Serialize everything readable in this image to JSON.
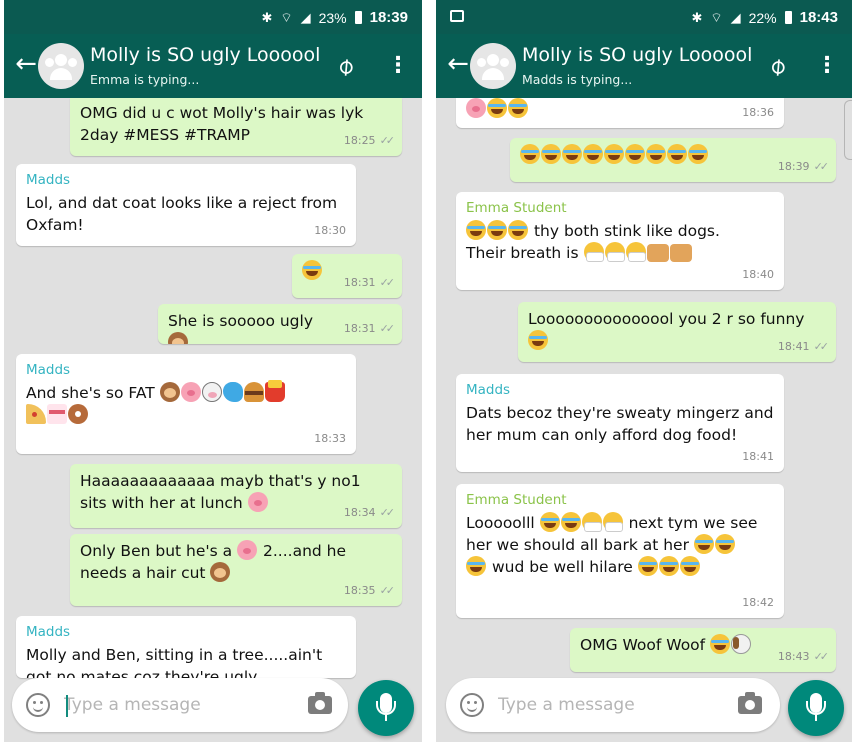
{
  "left": {
    "status": {
      "bluetooth": "✱",
      "wifi": "⌔",
      "signal": "◢",
      "battery": "23%",
      "time": "18:39"
    },
    "header": {
      "title": "Molly is SO ugly Loooool",
      "subtitle": "Emma is typing..."
    },
    "messages": [
      {
        "text": "OMG did u c wot Molly's hair was lyk 2day #MESS #TRAMP",
        "time": "18:25"
      },
      {
        "sender": "Madds",
        "text": "Lol, and dat coat looks like a reject from Oxfam!",
        "time": "18:30"
      },
      {
        "text": "",
        "time": "18:31"
      },
      {
        "text": "She is sooooo ugly",
        "time": "18:31"
      },
      {
        "sender": "Madds",
        "text": "And she's so FAT",
        "time": "18:33"
      },
      {
        "text": "Haaaaaaaaaaaaa mayb that's y no1 sits with her at lunch",
        "time": "18:34"
      },
      {
        "text1": "Only Ben but he's a",
        "text2": "2....and he needs a hair cut",
        "time": "18:35"
      },
      {
        "sender": "Madds",
        "text": "Molly and Ben, sitting in a tree.....ain't got no mates coz they're ugly",
        "time": ""
      }
    ],
    "input": {
      "placeholder": "Type a message"
    }
  },
  "right": {
    "status": {
      "bluetooth": "✱",
      "wifi": "⌔",
      "signal": "◢",
      "battery": "22%",
      "time": "18:43"
    },
    "header": {
      "title": "Molly is SO ugly Loooool",
      "subtitle": "Madds is typing..."
    },
    "messages": [
      {
        "text": "",
        "time": "18:36"
      },
      {
        "text": "",
        "time": "18:39"
      },
      {
        "sender": "Emma Student",
        "text1": "thy both stink like dogs.",
        "text2": "Their breath is",
        "time": "18:40"
      },
      {
        "text": "Looooooooooooool you 2 r so funny",
        "time": "18:41"
      },
      {
        "sender": "Madds",
        "text": "Dats becoz they're sweaty mingerz and her mum can only afford dog food!",
        "time": "18:41"
      },
      {
        "sender": "Emma Student",
        "text1": "Looooolll",
        "text2": "next tym we see her we should all bark at her",
        "text3": "wud be well hilare",
        "time": "18:42"
      },
      {
        "text": "OMG Woof Woof",
        "time": "18:43"
      }
    ],
    "input": {
      "placeholder": "Type a message"
    }
  },
  "colors": {
    "header": "#075e54",
    "statusbar": "#0b5a51",
    "outgoing": "#dcf8c6",
    "incoming": "#ffffff",
    "background": "#e0e0e0",
    "fab": "#00897b",
    "sender_teal": "#35b4c2",
    "sender_green": "#8bc34a"
  },
  "icons": {
    "back": "arrow-left-icon",
    "attach": "paperclip-icon",
    "menu": "more-vert-icon",
    "emoji": "smiley-icon",
    "camera": "camera-icon",
    "mic": "mic-icon",
    "ticks": "double-check-icon"
  },
  "glyphs": {
    "back": "←",
    "attach": "⌀",
    "menu": "⋮",
    "ticks": "✓✓"
  }
}
